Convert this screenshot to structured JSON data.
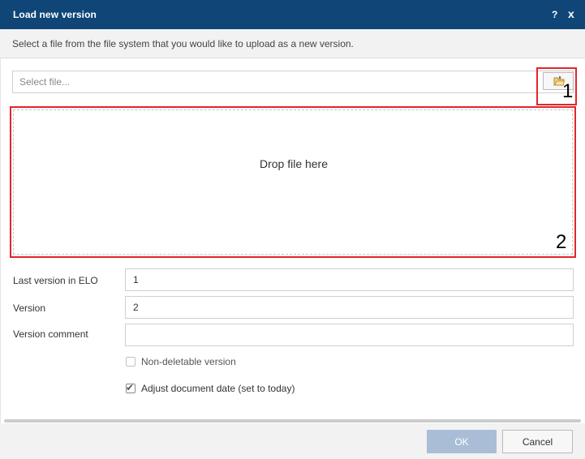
{
  "dialog": {
    "title": "Load new version",
    "help_label": "?",
    "close_label": "x",
    "instruction": "Select a file from the file system that you would like to upload as a new version."
  },
  "file_picker": {
    "placeholder": "Select file...",
    "value": "",
    "browse_icon": "folder-open-icon"
  },
  "drop_zone": {
    "label": "Drop file here"
  },
  "annotations": [
    {
      "label": "1"
    },
    {
      "label": "2"
    }
  ],
  "form": {
    "last_version_label": "Last version in ELO",
    "last_version_value": "1",
    "version_label": "Version",
    "version_value": "2",
    "comment_label": "Version comment",
    "comment_value": "",
    "non_deletable_label": "Non-deletable version",
    "non_deletable_checked": false,
    "adjust_date_label": "Adjust document date (set to today)",
    "adjust_date_checked": true
  },
  "footer": {
    "ok_label": "OK",
    "cancel_label": "Cancel"
  },
  "colors": {
    "titlebar": "#0f4677",
    "annotation": "#e2262a",
    "ok_button": "#a9bed6"
  }
}
